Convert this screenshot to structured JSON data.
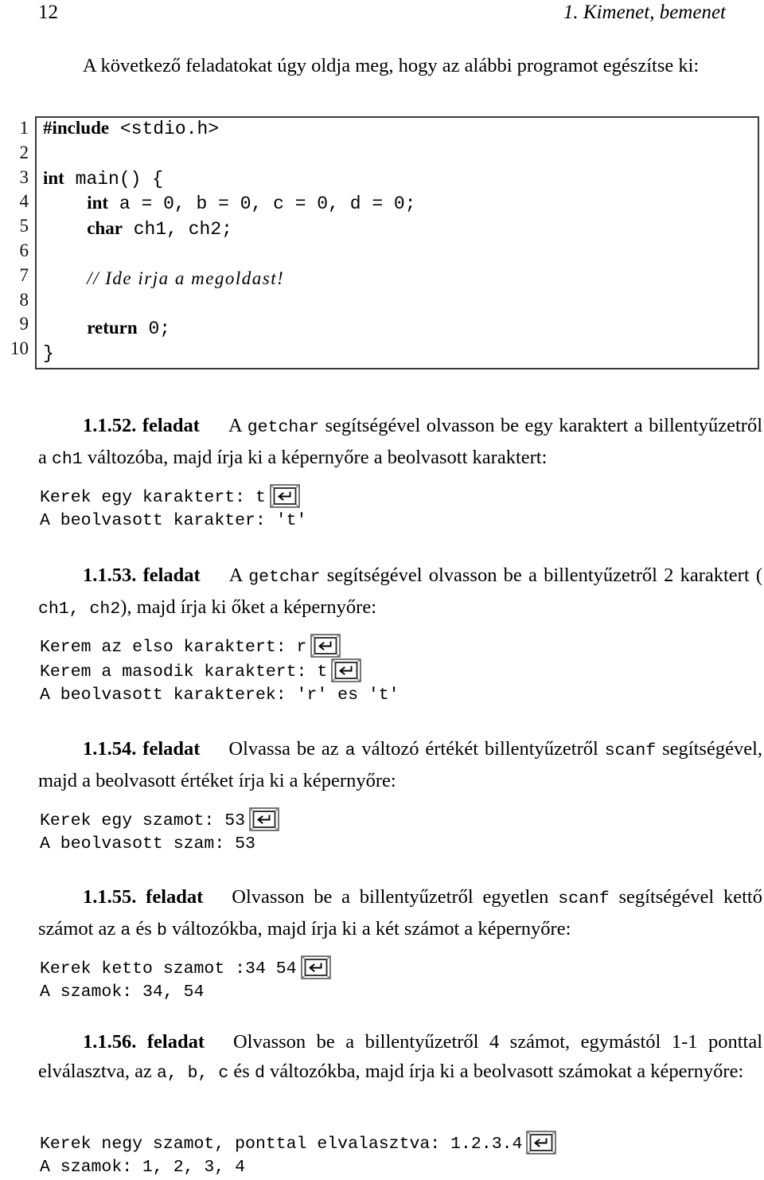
{
  "header": {
    "folio": "12",
    "chapter_title": "1. Kimenet, bemenet"
  },
  "intro": {
    "text": "A következő feladatokat úgy oldja meg, hogy az alábbi programot egészítse ki:"
  },
  "listing": {
    "line_numbers": [
      "1",
      "2",
      "3",
      "4",
      "5",
      "6",
      "7",
      "8",
      "9",
      "10"
    ],
    "lines": [
      "#include <stdio.h>",
      "",
      "int main() {",
      "    int a = 0, b = 0, c = 0, d = 0;",
      "    char ch1, ch2;",
      "",
      "    // Ide irja a megoldast!",
      "",
      "    return 0;",
      "}"
    ]
  },
  "icons": {
    "enter_key": "enter-key-icon"
  },
  "exercises": [
    {
      "number": "1.1.52.",
      "label": "feladat",
      "body_part1": "A ",
      "code1": "getchar",
      "body_part2": " segítségével olvasson be egy karaktert a billentyűzetről a ",
      "code2": "ch1",
      "body_part3": " változóba, majd írja ki a képernyőre a beolvasott karaktert:",
      "terminal": [
        {
          "text": "Kerek egy karaktert: t",
          "enter": true
        },
        {
          "text": "A beolvasott karakter: ʹtʹ",
          "enter": false
        }
      ]
    },
    {
      "number": "1.1.53.",
      "label": "feladat",
      "body_part1": "A ",
      "code1": "getchar",
      "body_part2": " segítségével olvasson be a billentyűzetről 2 karaktert ( ",
      "code2": "ch1,  ch2",
      "body_part3": "), majd írja ki őket a képernyőre:",
      "terminal": [
        {
          "text": "Kerem az elso karaktert: r",
          "enter": true
        },
        {
          "text": "Kerem a masodik karaktert: t",
          "enter": true
        },
        {
          "text": "A beolvasott karakterek: ʹrʹ es ʹtʹ",
          "enter": false
        }
      ]
    },
    {
      "number": "1.1.54.",
      "label": "feladat",
      "body_part1": "Olvassa be az ",
      "code1": "a",
      "body_part2": " változó értékét billentyűzetről ",
      "code2": "scanf",
      "body_part3": " segítségével, majd a beolvasott értéket írja ki a képernyőre:",
      "terminal": [
        {
          "text": "Kerek egy szamot: 53",
          "enter": true
        },
        {
          "text": "A beolvasott szam: 53",
          "enter": false
        }
      ]
    },
    {
      "number": "1.1.55.",
      "label": "feladat",
      "body_part1": "Olvasson be a billentyűzetről egyetlen ",
      "code1": "scanf",
      "body_part2": " segítségével kettő számot az ",
      "code2": "a",
      "body_part3": " és ",
      "code3": "b",
      "body_part4": " változókba, majd írja ki a két számot a képernyőre:",
      "terminal": [
        {
          "text": "Kerek ketto szamot :34 54",
          "enter": true
        },
        {
          "text": "A szamok: 34, 54",
          "enter": false
        }
      ]
    },
    {
      "number": "1.1.56.",
      "label": "feladat",
      "body_part1": "Olvasson be a billentyűzetről 4 számot, egymástól 1-1 ponttal elválasztva, az ",
      "code1": "a,  b,  c",
      "body_part2": " és ",
      "code2": "d",
      "body_part3": " változókba, majd írja ki a beolvasott számokat a képernyőre:",
      "terminal": [
        {
          "text": "Kerek negy szamot, ponttal elvalasztva: 1.2.3.4",
          "enter": true
        },
        {
          "text": "A szamok: 1, 2, 3, 4",
          "enter": false
        }
      ]
    }
  ]
}
